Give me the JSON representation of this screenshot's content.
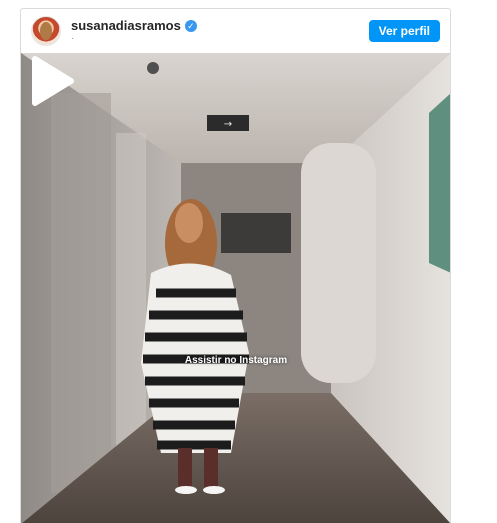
{
  "header": {
    "username": "susanadiasramos",
    "subline": "·",
    "profile_button": "Ver perfil"
  },
  "media": {
    "watch_label": "Assistir no Instagram",
    "play_icon": "play-icon",
    "exit_sign_icon": "exit-sign-icon"
  },
  "colors": {
    "button_blue": "#0095f6",
    "verified_blue": "#3897f0",
    "border": "#dbdbdb"
  }
}
